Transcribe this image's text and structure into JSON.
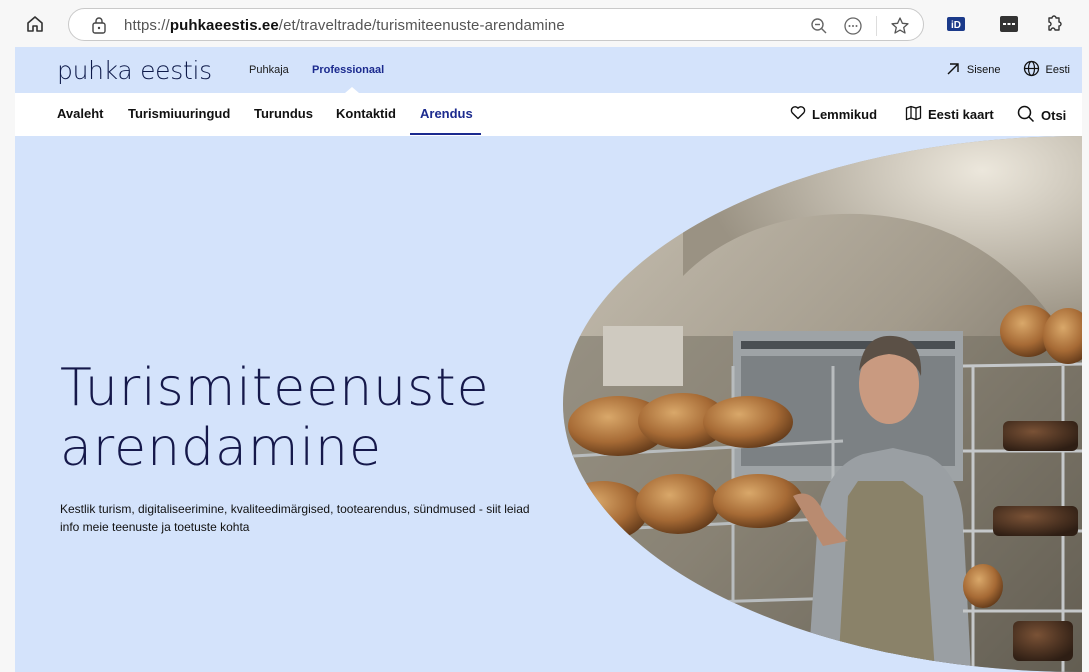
{
  "browser": {
    "url_prefix": "https://",
    "url_domain": "puhkaeestis.ee",
    "url_path": "/et/traveltrade/turismiteenuste-arendamine",
    "icons": [
      "home-icon",
      "lock-icon",
      "zoom-out-icon",
      "more-icon",
      "star-icon",
      "id-extension-icon",
      "extension-icon",
      "extensions-puzzle-icon"
    ],
    "extension_label": "iD"
  },
  "site": {
    "logo": "puhka eestis",
    "audience": [
      "Puhkaja",
      "Professionaal"
    ],
    "top_links": {
      "login": "Sisene",
      "language": "Eesti"
    },
    "nav": [
      "Avaleht",
      "Turismiuuringud",
      "Turundus",
      "Kontaktid",
      "Arendus"
    ],
    "active_nav": "Arendus",
    "tools": {
      "favorites": "Lemmikud",
      "map": "Eesti kaart",
      "search": "Otsi"
    },
    "colors": {
      "accent": "#1b2a8e",
      "hero_bg": "#d4e3fb",
      "title": "#15184a"
    }
  },
  "hero": {
    "title_line1": "Turismiteenuste",
    "title_line2": "arendamine",
    "description": "Kestlik turism, digitaliseerimine, kvaliteedimärgised, tootearendus, sündmused - siit leiad info meie teenuste ja toetuste kohta",
    "image": "baker-with-bread-racks-photo"
  }
}
